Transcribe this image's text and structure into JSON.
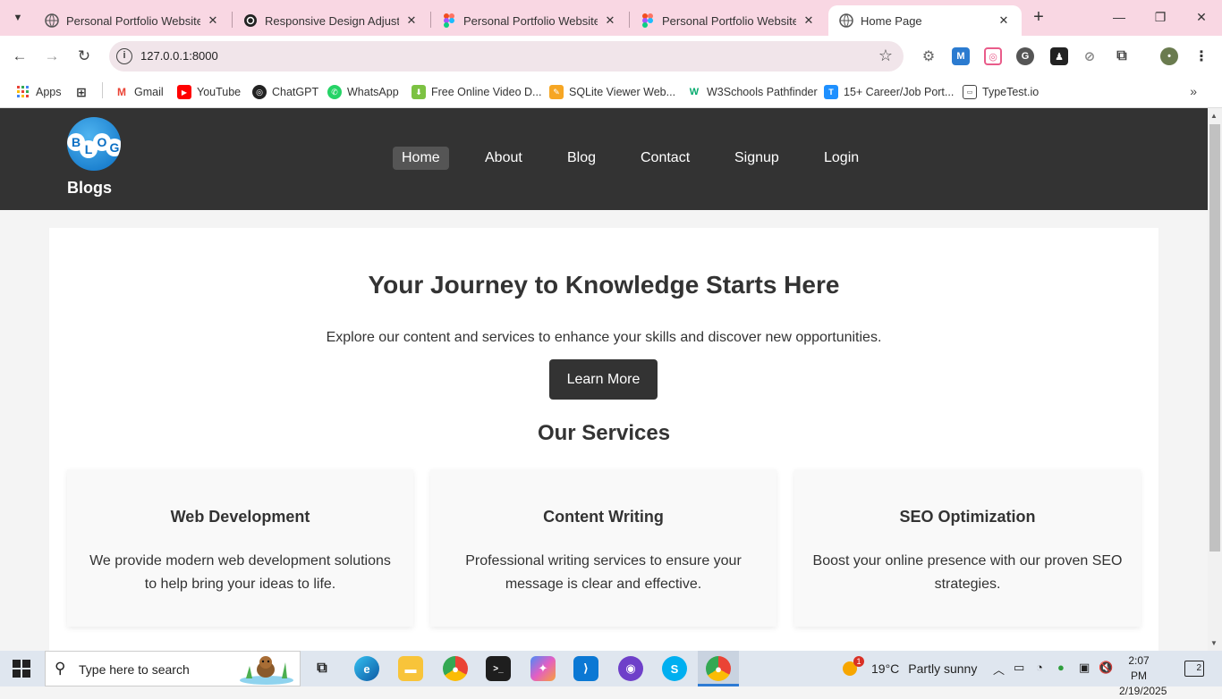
{
  "browser": {
    "tabs": [
      {
        "label": "Personal Portfolio Website",
        "icon": "globe-icon"
      },
      {
        "label": "Responsive Design Adjustme",
        "icon": "chatgpt-icon"
      },
      {
        "label": "Personal Portfolio Website Te",
        "icon": "figma-icon"
      },
      {
        "label": "Personal Portfolio Website Te",
        "icon": "figma-icon"
      },
      {
        "label": "Home Page",
        "icon": "globe-icon",
        "active": true
      }
    ],
    "url": "127.0.0.1:8000",
    "bookmarks": [
      {
        "label": "Apps",
        "icon": "apps-grid-icon"
      },
      {
        "label": "Gmail",
        "icon": "gmail-icon"
      },
      {
        "label": "YouTube",
        "icon": "youtube-icon"
      },
      {
        "label": "ChatGPT",
        "icon": "chatgpt-icon"
      },
      {
        "label": "WhatsApp",
        "icon": "whatsapp-icon"
      },
      {
        "label": "Free Online Video D...",
        "icon": "download-icon"
      },
      {
        "label": "SQLite Viewer Web...",
        "icon": "sqlite-icon"
      },
      {
        "label": "W3Schools Pathfinder",
        "icon": "w3schools-icon"
      },
      {
        "label": "15+ Career/Job Port...",
        "icon": "t-icon"
      },
      {
        "label": "TypeTest.io",
        "icon": "keyboard-icon"
      }
    ]
  },
  "site": {
    "logo_letters": [
      "B",
      "L",
      "O",
      "G"
    ],
    "brand": "Blogs",
    "nav": [
      {
        "label": "Home",
        "active": true
      },
      {
        "label": "About"
      },
      {
        "label": "Blog"
      },
      {
        "label": "Contact"
      },
      {
        "label": "Signup"
      },
      {
        "label": "Login"
      }
    ],
    "hero": {
      "title": "Your Journey to Knowledge Starts Here",
      "subtitle": "Explore our content and services to enhance your skills and discover new opportunities.",
      "button": "Learn More"
    },
    "services": {
      "title": "Our Services",
      "cards": [
        {
          "title": "Web Development",
          "text": "We provide modern web development solutions to help bring your ideas to life."
        },
        {
          "title": "Content Writing",
          "text": "Professional writing services to ensure your message is clear and effective."
        },
        {
          "title": "SEO Optimization",
          "text": "Boost your online presence with our proven SEO strategies."
        }
      ]
    }
  },
  "taskbar": {
    "search_placeholder": "Type here to search",
    "weather": {
      "temp": "19°C",
      "condition": "Partly sunny",
      "badge": "1"
    },
    "time": "2:07 PM",
    "date": "2/19/2025",
    "notifications": "2"
  },
  "colors": {
    "header_bg": "#333333",
    "tabbar_bg": "#f9d7e3",
    "nav_active": "#555555",
    "button_bg": "#333333"
  }
}
